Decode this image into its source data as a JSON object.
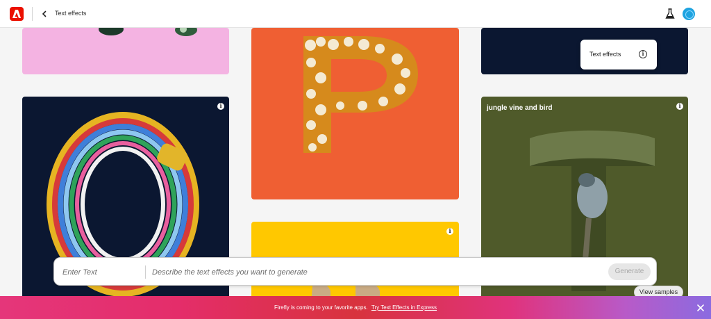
{
  "header": {
    "title": "Text effects"
  },
  "icons": {
    "logo": "adobe-logo-icon",
    "back": "chevron-left-icon",
    "labs": "beaker-icon",
    "avatar": "user-avatar",
    "info": "info-icon",
    "close": "close-icon"
  },
  "cards": {
    "olive_caption": "jungle vine and bird"
  },
  "tooltip": {
    "label": "Text effects"
  },
  "prompt": {
    "text_placeholder": "Enter Text",
    "description_placeholder": "Describe the text effects you want to generate",
    "generate_label": "Generate"
  },
  "view_samples_label": "View samples",
  "banner": {
    "message": "Firefly is coming to your favorite apps.",
    "link": "Try Text Effects in Express"
  },
  "colors": {
    "brand_red": "#eb1000",
    "pink_card": "#f4b3e2",
    "orange_card": "#ef5f33",
    "navy_card": "#0b1731",
    "olive_card": "#4f5a2a",
    "yellow_card": "#ffc800"
  }
}
